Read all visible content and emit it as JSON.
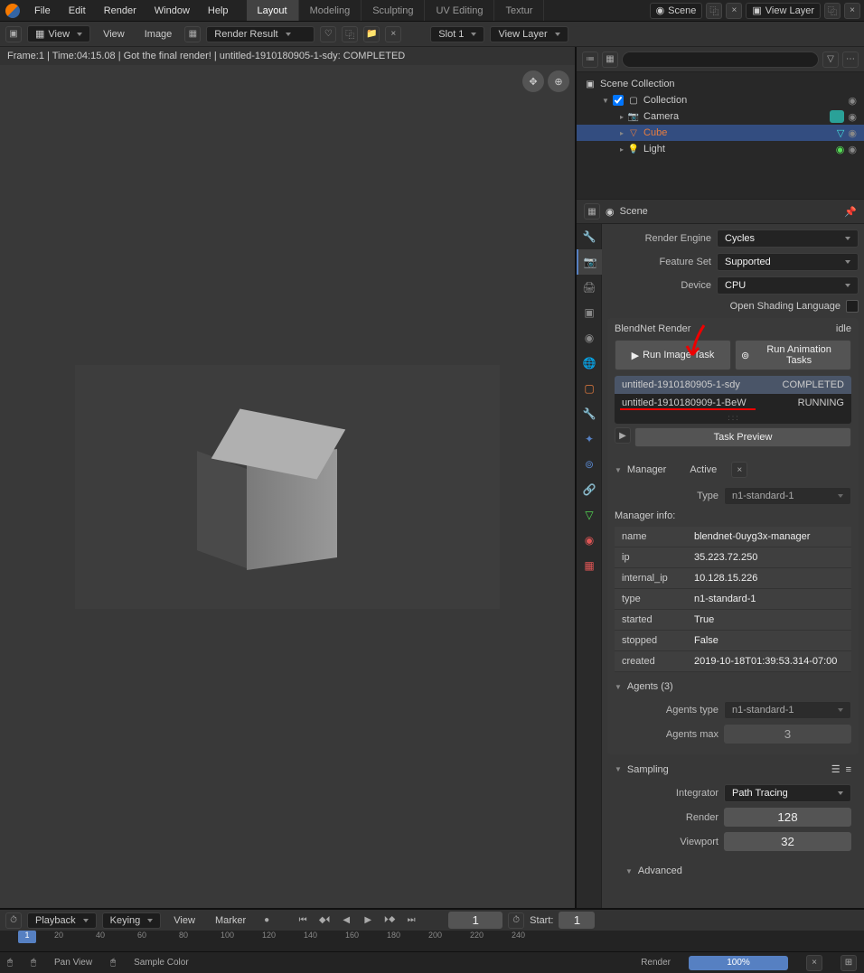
{
  "topbar": {
    "menus": [
      "File",
      "Edit",
      "Render",
      "Window",
      "Help"
    ],
    "workspaces": [
      "Layout",
      "Modeling",
      "Sculpting",
      "UV Editing",
      "Textur"
    ],
    "active_workspace": "Layout",
    "scene_label": "Scene",
    "viewlayer_label": "View Layer"
  },
  "toolbar": {
    "view": "View",
    "view2": "View",
    "image": "Image",
    "render_result": "Render Result",
    "slot": "Slot 1",
    "viewlayer": "View Layer"
  },
  "status_line": "Frame:1 | Time:04:15.08 | Got the final render! | untitled-1910180905-1-sdy: COMPLETED",
  "outliner": {
    "root": "Scene Collection",
    "collection": "Collection",
    "items": [
      {
        "name": "Camera",
        "icon": "camera"
      },
      {
        "name": "Cube",
        "icon": "cube",
        "selected": true
      },
      {
        "name": "Light",
        "icon": "light"
      }
    ]
  },
  "props_header": "Scene",
  "render": {
    "engine_label": "Render Engine",
    "engine": "Cycles",
    "feature_label": "Feature Set",
    "feature": "Supported",
    "device_label": "Device",
    "device": "CPU",
    "osl": "Open Shading Language"
  },
  "blendnet": {
    "title": "BlendNet Render",
    "status": "idle",
    "run_image": "Run Image Task",
    "run_anim": "Run Animation Tasks",
    "tasks": [
      {
        "name": "untitled-1910180905-1-sdy",
        "status": "COMPLETED",
        "selected": true
      },
      {
        "name": "untitled-1910180909-1-BeW",
        "status": "RUNNING"
      }
    ],
    "preview": "Task Preview",
    "manager": "Manager",
    "manager_status": "Active",
    "type_label": "Type",
    "type_value": "n1-standard-1",
    "info_label": "Manager info:",
    "info": [
      {
        "k": "name",
        "v": "blendnet-0uyg3x-manager"
      },
      {
        "k": "ip",
        "v": "35.223.72.250"
      },
      {
        "k": "internal_ip",
        "v": "10.128.15.226"
      },
      {
        "k": "type",
        "v": "n1-standard-1"
      },
      {
        "k": "started",
        "v": "True"
      },
      {
        "k": "stopped",
        "v": "False"
      },
      {
        "k": "created",
        "v": "2019-10-18T01:39:53.314-07:00"
      }
    ],
    "agents_header": "Agents (3)",
    "agents_type_label": "Agents type",
    "agents_type": "n1-standard-1",
    "agents_max_label": "Agents max",
    "agents_max": "3"
  },
  "sampling": {
    "header": "Sampling",
    "integrator_label": "Integrator",
    "integrator": "Path Tracing",
    "render_label": "Render",
    "render_samples": "128",
    "viewport_label": "Viewport",
    "viewport_samples": "32",
    "advanced": "Advanced"
  },
  "timeline": {
    "playback": "Playback",
    "keying": "Keying",
    "view": "View",
    "marker": "Marker",
    "frame": "1",
    "start_label": "Start:",
    "start": "1",
    "ticks": [
      "20",
      "40",
      "60",
      "80",
      "100",
      "120",
      "140",
      "160",
      "180",
      "200",
      "220",
      "240"
    ]
  },
  "bottombar": {
    "pan": "Pan View",
    "sample": "Sample Color",
    "render": "Render",
    "progress": "100%"
  }
}
